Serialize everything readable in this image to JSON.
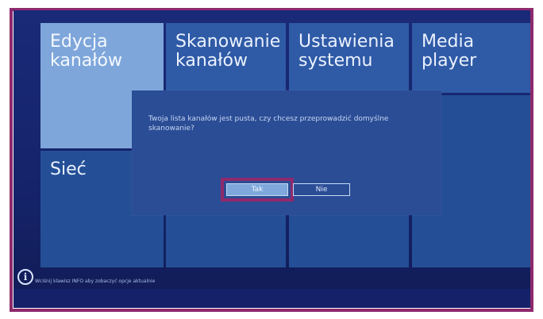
{
  "menu": {
    "tiles": [
      {
        "line1": "Edycja",
        "line2": "kanałów"
      },
      {
        "line1": "Skanowanie",
        "line2": "kanałów"
      },
      {
        "line1": "Ustawienia",
        "line2": "systemu"
      },
      {
        "line1": "Media",
        "line2": "player"
      },
      {
        "line1": "Sieć",
        "line2": ""
      }
    ]
  },
  "dialog": {
    "message": "Twoja lista kanałów jest pusta, czy chcesz przeprowadzić domyślne skanowanie?",
    "yes_label": "Tak",
    "no_label": "Nie"
  },
  "footer": {
    "hint": "Wciśnij klawisz INFO aby zobaczyć opcje aktualnie"
  },
  "colors": {
    "frame_accent": "#8e2a6d",
    "tile_active": "#7ea6da",
    "tile": "#2f5aa6",
    "background": "#1a2a78"
  }
}
